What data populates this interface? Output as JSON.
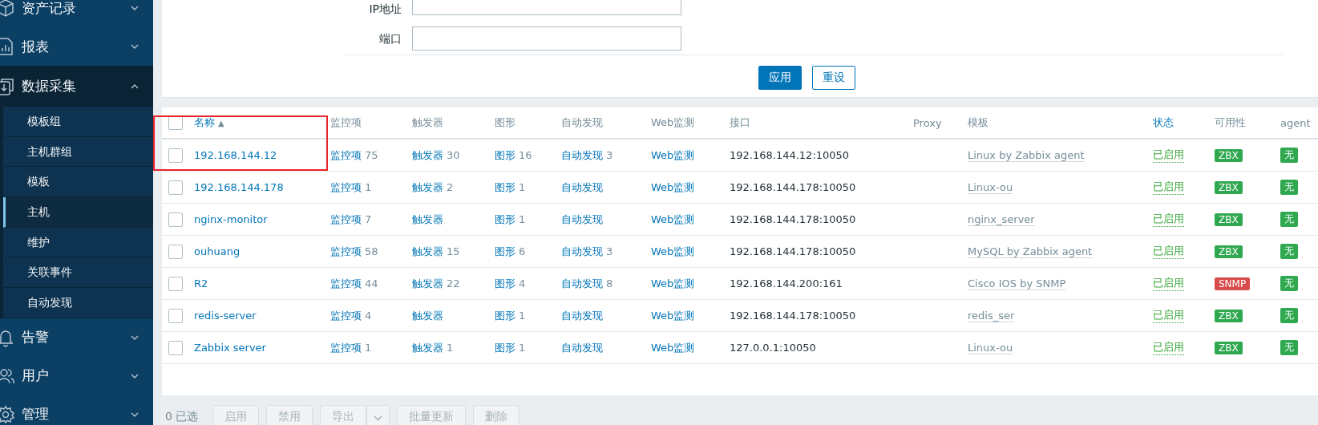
{
  "sidebar": {
    "items": [
      {
        "label": "资产记录",
        "expanded": false
      },
      {
        "label": "报表",
        "expanded": false
      },
      {
        "label": "数据采集",
        "expanded": true,
        "children": [
          {
            "label": "模板组",
            "selected": false
          },
          {
            "label": "主机群组",
            "selected": false
          },
          {
            "label": "模板",
            "selected": false
          },
          {
            "label": "主机",
            "selected": true
          },
          {
            "label": "维护",
            "selected": false
          },
          {
            "label": "关联事件",
            "selected": false
          },
          {
            "label": "自动发现",
            "selected": false
          }
        ]
      },
      {
        "label": "告警",
        "expanded": false
      },
      {
        "label": "用户",
        "expanded": false
      },
      {
        "label": "管理",
        "expanded": false
      }
    ]
  },
  "filter": {
    "fields": [
      {
        "label": "IP地址"
      },
      {
        "label": "端口"
      }
    ],
    "buttons": [
      {
        "label": "应用",
        "kind": "primary"
      },
      {
        "label": "重设",
        "kind": "outline"
      }
    ]
  },
  "table": {
    "annotation_box": true,
    "header_checked": false,
    "columns": [
      {
        "label": "名称",
        "sortable": true,
        "sort_mark": "▲"
      },
      {
        "label": "监控项",
        "sortable": false
      },
      {
        "label": "触发器",
        "sortable": false
      },
      {
        "label": "图形",
        "sortable": false
      },
      {
        "label": "自动发现",
        "sortable": false
      },
      {
        "label": "Web监测",
        "sortable": false
      },
      {
        "label": "接口",
        "sortable": false
      },
      {
        "label": "Proxy",
        "sortable": false
      },
      {
        "label": "模板",
        "sortable": false
      },
      {
        "label": "状态",
        "sortable": true
      },
      {
        "label": "可用性",
        "sortable": false
      },
      {
        "label": "agent",
        "sortable": false
      }
    ],
    "rows": [
      {
        "checked": false,
        "name": "192.168.144.12",
        "links": [
          {
            "label": "监控项",
            "count": "75"
          },
          {
            "label": "触发器",
            "count": "30"
          },
          {
            "label": "图形",
            "count": "16"
          },
          {
            "label": "自动发现",
            "count": "3"
          },
          {
            "label": "Web监测"
          }
        ],
        "interface": "192.168.144.12:10050",
        "template": "Linux by Zabbix agent",
        "status": "已启用",
        "availability": {
          "label": "ZBX",
          "color": "#2fa84f"
        },
        "encryption": "无"
      },
      {
        "checked": false,
        "name": "192.168.144.178",
        "links": [
          {
            "label": "监控项",
            "count": "1"
          },
          {
            "label": "触发器",
            "count": "2"
          },
          {
            "label": "图形",
            "count": "1"
          },
          {
            "label": "自动发现"
          },
          {
            "label": "Web监测"
          }
        ],
        "interface": "192.168.144.178:10050",
        "template": "Linux-ou",
        "status": "已启用",
        "availability": {
          "label": "ZBX",
          "color": "#2fa84f"
        },
        "encryption": "无"
      },
      {
        "checked": false,
        "name": "nginx-monitor",
        "links": [
          {
            "label": "监控项",
            "count": "7"
          },
          {
            "label": "触发器"
          },
          {
            "label": "图形",
            "count": "1"
          },
          {
            "label": "自动发现"
          },
          {
            "label": "Web监测"
          }
        ],
        "interface": "192.168.144.178:10050",
        "template": "nginx_server",
        "status": "已启用",
        "availability": {
          "label": "ZBX",
          "color": "#2fa84f"
        },
        "encryption": "无"
      },
      {
        "checked": false,
        "name": "ouhuang",
        "links": [
          {
            "label": "监控项",
            "count": "58"
          },
          {
            "label": "触发器",
            "count": "15"
          },
          {
            "label": "图形",
            "count": "6"
          },
          {
            "label": "自动发现",
            "count": "3"
          },
          {
            "label": "Web监测"
          }
        ],
        "interface": "192.168.144.178:10050",
        "template": "MySQL by Zabbix agent",
        "status": "已启用",
        "availability": {
          "label": "ZBX",
          "color": "#2fa84f"
        },
        "encryption": "无"
      },
      {
        "checked": false,
        "name": "R2",
        "links": [
          {
            "label": "监控项",
            "count": "44"
          },
          {
            "label": "触发器",
            "count": "22"
          },
          {
            "label": "图形",
            "count": "4"
          },
          {
            "label": "自动发现",
            "count": "8"
          },
          {
            "label": "Web监测"
          }
        ],
        "interface": "192.168.144.200:161",
        "template": "Cisco IOS by SNMP",
        "status": "已启用",
        "availability": {
          "label": "SNMP",
          "color": "#d84b4b"
        },
        "encryption": "无"
      },
      {
        "checked": false,
        "name": "redis-server",
        "links": [
          {
            "label": "监控项",
            "count": "4"
          },
          {
            "label": "触发器"
          },
          {
            "label": "图形",
            "count": "1"
          },
          {
            "label": "自动发现"
          },
          {
            "label": "Web监测"
          }
        ],
        "interface": "192.168.144.178:10050",
        "template": "redis_ser",
        "status": "已启用",
        "availability": {
          "label": "ZBX",
          "color": "#2fa84f"
        },
        "encryption": "无"
      },
      {
        "checked": false,
        "name": "Zabbix server",
        "links": [
          {
            "label": "监控项",
            "count": "1"
          },
          {
            "label": "触发器",
            "count": "1"
          },
          {
            "label": "图形",
            "count": "1"
          },
          {
            "label": "自动发现"
          },
          {
            "label": "Web监测"
          }
        ],
        "interface": "127.0.0.1:10050",
        "template": "Linux-ou",
        "status": "已启用",
        "availability": {
          "label": "ZBX",
          "color": "#2fa84f"
        },
        "encryption": "无"
      }
    ]
  },
  "footer": {
    "selected_count": "0 已选",
    "buttons": [
      {
        "label": "启用",
        "disabled": true,
        "dropdown": false
      },
      {
        "label": "禁用",
        "disabled": true,
        "dropdown": false
      },
      {
        "label": "导出",
        "disabled": true,
        "dropdown": true
      },
      {
        "label": "批量更新",
        "disabled": true,
        "dropdown": false
      },
      {
        "label": "删除",
        "disabled": true,
        "dropdown": false
      }
    ]
  }
}
